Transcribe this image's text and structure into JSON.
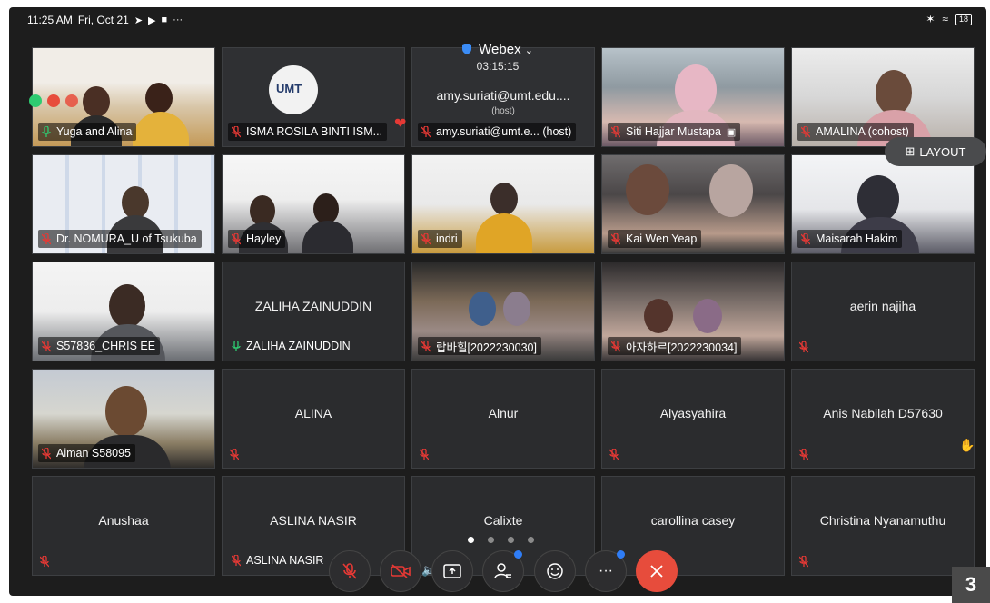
{
  "status_bar": {
    "time": "11:25 AM",
    "date": "Fri, Oct 21",
    "more": "···",
    "battery": "18"
  },
  "meeting": {
    "app_name": "Webex",
    "timer": "03:15:15"
  },
  "layout_button": {
    "label": "LAYOUT",
    "icon": "grid-icon"
  },
  "tiles": [
    {
      "name": "Yuga and Alina",
      "type": "video",
      "mic": "on"
    },
    {
      "name": "ISMA ROSILA BINTI ISM...",
      "type": "video",
      "mic": "muted"
    },
    {
      "center": "amy.suriati@umt.edu....",
      "sub": "(host)",
      "name": "amy.suriati@umt.e... (host)",
      "type": "avatar",
      "mic": "muted"
    },
    {
      "name": "Siti Hajjar Mustapa",
      "type": "video",
      "mic": "muted",
      "sharing": true
    },
    {
      "name": "AMALINA (cohost)",
      "type": "video",
      "mic": "muted"
    },
    {
      "name": "Dr. NOMURA_U of Tsukuba",
      "type": "video",
      "mic": "muted"
    },
    {
      "name": "Hayley",
      "type": "video",
      "mic": "muted"
    },
    {
      "name": "indri",
      "type": "video",
      "mic": "muted"
    },
    {
      "name": "Kai Wen Yeap",
      "type": "video",
      "mic": "muted"
    },
    {
      "name": "Maisarah Hakim",
      "type": "video",
      "mic": "muted"
    },
    {
      "name": "S57836_CHRIS EE",
      "type": "video",
      "mic": "muted"
    },
    {
      "center": "ZALIHA ZAINUDDIN",
      "name": "ZALIHA ZAINUDDIN",
      "type": "avatar",
      "mic": "on"
    },
    {
      "name": "랍바힐[2022230030]",
      "type": "video",
      "mic": "muted"
    },
    {
      "name": "아자하르[2022230034]",
      "type": "video",
      "mic": "muted"
    },
    {
      "center": "aerin najiha",
      "type": "avatar",
      "mic": "muted"
    },
    {
      "name": "Aiman S58095",
      "type": "video",
      "mic": "muted"
    },
    {
      "center": "ALINA",
      "type": "avatar",
      "mic": "muted"
    },
    {
      "center": "Alnur",
      "type": "avatar",
      "mic": "muted"
    },
    {
      "center": "Alyasyahira",
      "type": "avatar",
      "mic": "muted"
    },
    {
      "center": "Anis Nabilah D57630",
      "type": "avatar",
      "mic": "muted",
      "raised_hand": true
    },
    {
      "center": "Anushaa",
      "type": "avatar",
      "mic": "muted"
    },
    {
      "center": "ASLINA NASIR",
      "name": "ASLINA NASIR",
      "type": "avatar",
      "mic": "muted"
    },
    {
      "center": "Calixte",
      "type": "avatar",
      "mic": "muted"
    },
    {
      "center": "carollina casey",
      "type": "avatar",
      "mic": "muted"
    },
    {
      "center": "Christina Nyanamuthu",
      "type": "avatar",
      "mic": "muted"
    }
  ],
  "pagination": {
    "pages": 4,
    "current": 1
  },
  "toolbar": [
    {
      "icon": "mic-muted-icon"
    },
    {
      "icon": "video-off-icon"
    },
    {
      "icon": "share-screen-icon"
    },
    {
      "icon": "participants-icon",
      "badge": true
    },
    {
      "icon": "reactions-icon"
    },
    {
      "icon": "more-icon",
      "label": "···",
      "badge": true
    },
    {
      "icon": "leave-meeting-icon",
      "color": "#e74c3c"
    }
  ],
  "page_badge": "3",
  "colors": {
    "muted": "#e53935",
    "on": "#2ecc71",
    "accent": "#2f7df6",
    "leave": "#e74c3c"
  }
}
